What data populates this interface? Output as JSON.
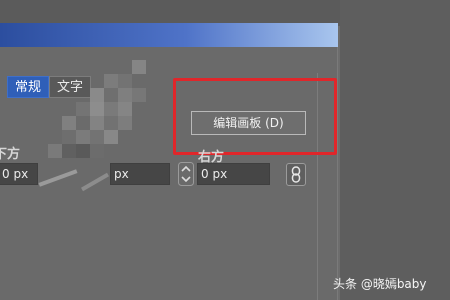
{
  "tabs": [
    {
      "label": "常规",
      "active": true
    },
    {
      "label": "文字",
      "active": false
    }
  ],
  "edit_artboard_button": "编辑画板 (D)",
  "labels": {
    "bottom": "下方",
    "right": "右方"
  },
  "fields": {
    "bottom_value": "0 px",
    "middle_value": "px",
    "right_value": "0 px"
  },
  "icons": {
    "stepper": "up-down-stepper-icon",
    "link": "link-chain-icon"
  },
  "highlight_color": "#e0262a",
  "watermark": "头条 @晓嫣baby"
}
